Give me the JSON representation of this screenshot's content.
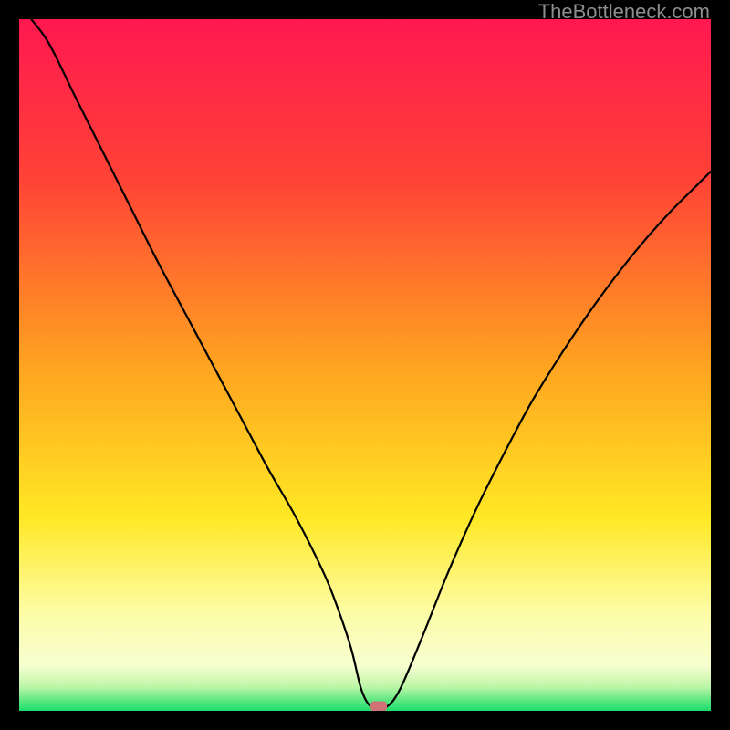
{
  "watermark": "TheBottleneck.com",
  "chart_data": {
    "type": "line",
    "title": "",
    "xlabel": "",
    "ylabel": "",
    "xlim": [
      0,
      100
    ],
    "ylim": [
      0,
      100
    ],
    "gradient_stops": [
      {
        "offset": 0,
        "color": "#ff1850"
      },
      {
        "offset": 0.23,
        "color": "#ff4236"
      },
      {
        "offset": 0.5,
        "color": "#ffa320"
      },
      {
        "offset": 0.72,
        "color": "#ffe824"
      },
      {
        "offset": 0.86,
        "color": "#fdfda8"
      },
      {
        "offset": 0.935,
        "color": "#f6fed0"
      },
      {
        "offset": 0.965,
        "color": "#bdf6a7"
      },
      {
        "offset": 0.985,
        "color": "#5de782"
      },
      {
        "offset": 1.0,
        "color": "#19df6c"
      }
    ],
    "series": [
      {
        "name": "bottleneck-curve",
        "x": [
          0,
          4,
          8,
          12,
          16,
          20,
          24,
          28,
          32,
          36,
          40,
          44,
          46,
          48,
          49.5,
          51,
          53,
          55,
          58,
          62,
          66,
          70,
          74,
          78,
          82,
          86,
          90,
          94,
          98,
          100
        ],
        "y": [
          102,
          97,
          89,
          81,
          73,
          65,
          57.5,
          50,
          42.5,
          35,
          28,
          20,
          15,
          9,
          3,
          0.5,
          0.5,
          3,
          10,
          20,
          29,
          37,
          44.5,
          51,
          57,
          62.5,
          67.5,
          72,
          76,
          78
        ]
      }
    ],
    "marker": {
      "x": 52.0,
      "y": 0.7
    }
  }
}
